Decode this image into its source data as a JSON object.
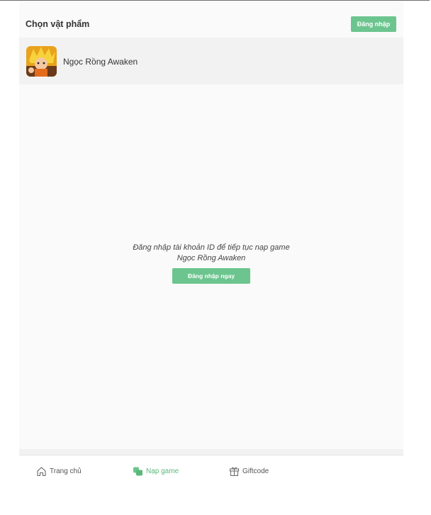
{
  "header": {
    "title": "Chọn vật phẩm",
    "login_label": "Đăng nhập"
  },
  "game": {
    "name": "Ngọc Rồng Awaken",
    "icon": "game-thumbnail"
  },
  "empty_state": {
    "message": "Đăng nhập tài khoản ID để tiếp tục nạp game",
    "game_name": "Ngọc Rồng Awaken",
    "button_label": "Đăng nhập ngay"
  },
  "nav": {
    "items": [
      {
        "label": "Trang chủ",
        "icon": "home-icon",
        "active": false
      },
      {
        "label": "Nạp game",
        "icon": "wallet-icon",
        "active": true
      },
      {
        "label": "Giftcode",
        "icon": "gift-icon",
        "active": false
      }
    ]
  },
  "colors": {
    "accent": "#6cc58e",
    "active_nav": "#59b87a",
    "panel_bg": "#fafafa"
  }
}
